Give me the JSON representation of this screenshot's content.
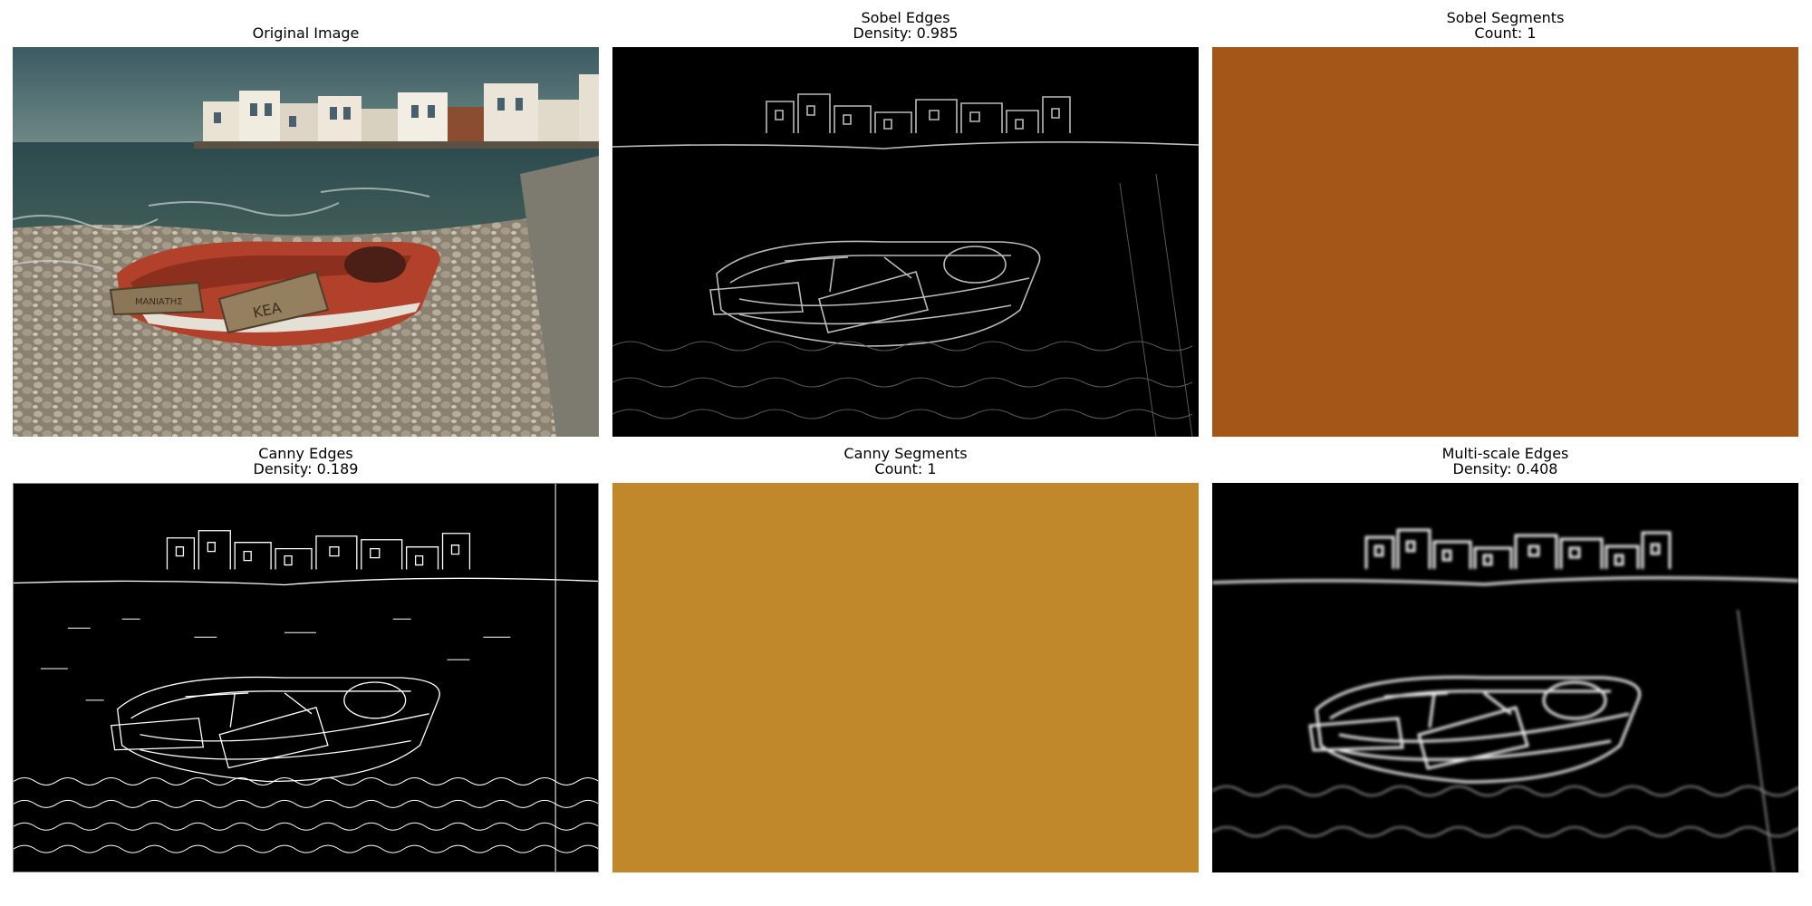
{
  "panels": [
    {
      "key": "original",
      "title": "Original Image",
      "subtitle": ""
    },
    {
      "key": "sobel_edges",
      "title": "Sobel Edges",
      "subtitle": "Density: 0.985"
    },
    {
      "key": "sobel_segments",
      "title": "Sobel Segments",
      "subtitle": "Count: 1",
      "fill_color": "#A35617"
    },
    {
      "key": "canny_edges",
      "title": "Canny Edges",
      "subtitle": "Density: 0.189"
    },
    {
      "key": "canny_segments",
      "title": "Canny Segments",
      "subtitle": "Count: 1",
      "fill_color": "#C0882A"
    },
    {
      "key": "multiscale_edges",
      "title": "Multi-scale Edges",
      "subtitle": "Density: 0.408"
    }
  ],
  "boat_letters": "KEA",
  "crate_letters": "ΜΑΝΙΑΤΗΣ"
}
